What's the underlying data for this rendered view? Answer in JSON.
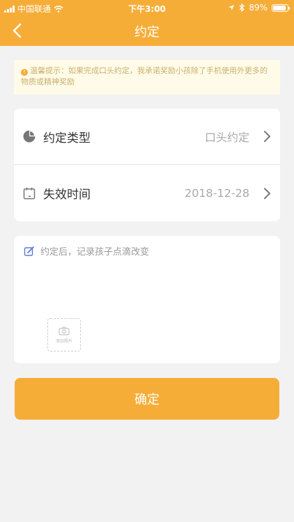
{
  "status_bar": {
    "carrier": "中国联通",
    "time": "下午3:00",
    "battery": "89%",
    "battery_level": 0.89
  },
  "nav": {
    "title": "约定",
    "back_icon": "chevron-left-icon"
  },
  "tip": {
    "text": "温馨提示：如果完成口头约定，我承诺奖励小孩除了手机使用外更多的物质或精神奖励"
  },
  "settings": {
    "type_label": "约定类型",
    "type_value": "口头约定",
    "expire_label": "失效时间",
    "expire_value": "2018-12-28"
  },
  "note": {
    "placeholder": "约定后，记录孩子点滴改变",
    "add_photo_label": "添加照片"
  },
  "actions": {
    "confirm_label": "确定"
  },
  "colors": {
    "accent": "#f6ad38",
    "background": "#f2f2f2",
    "tip_background": "#fffbe8"
  }
}
